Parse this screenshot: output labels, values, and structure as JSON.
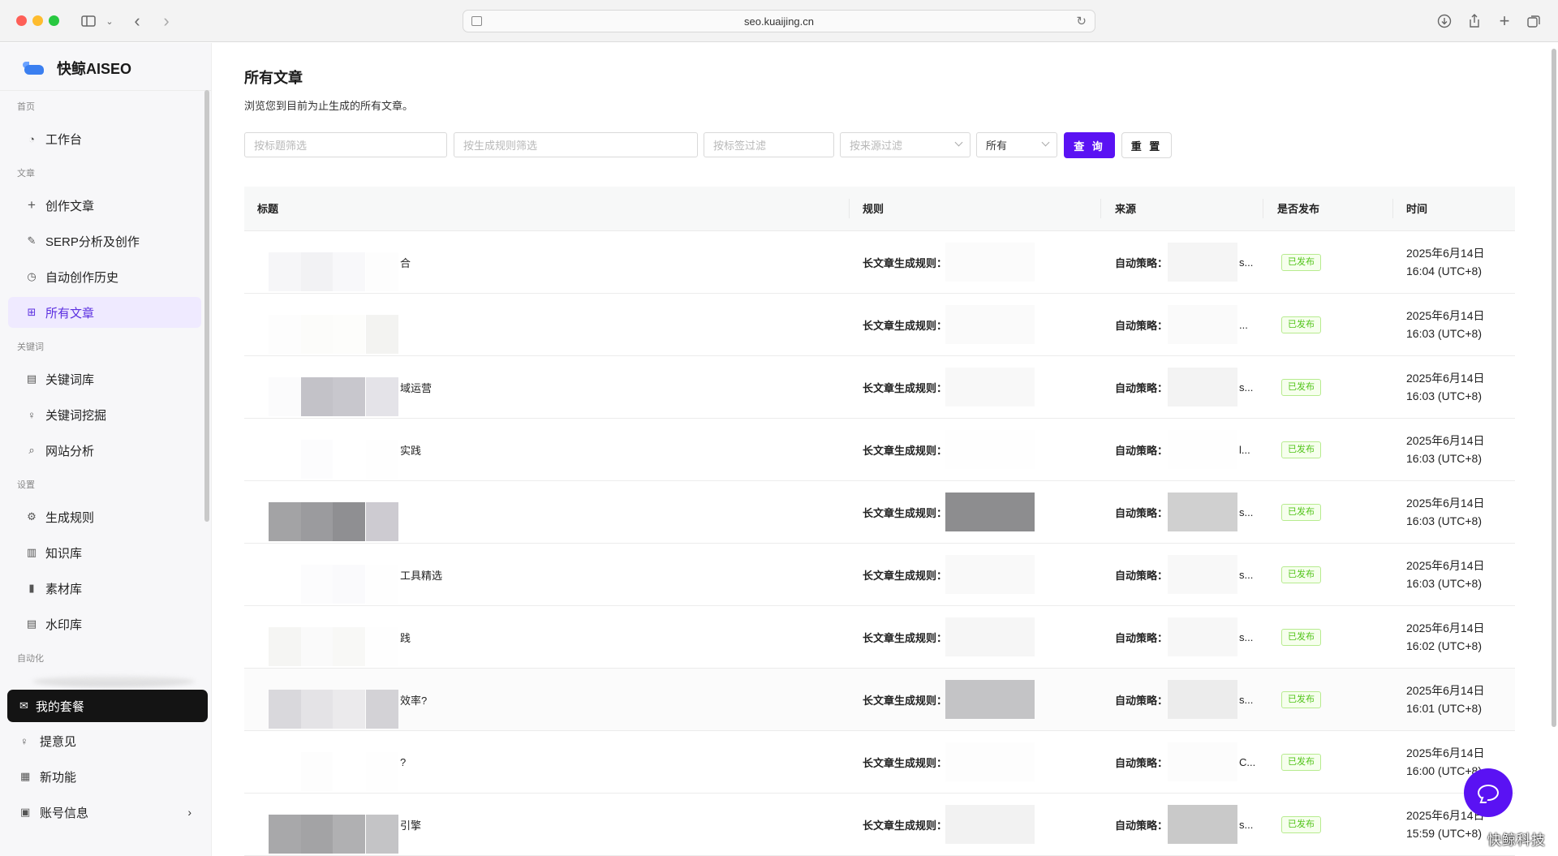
{
  "browser": {
    "url": "seo.kuaijing.cn"
  },
  "brand": {
    "name": "快鲸AISEO"
  },
  "sidebar": {
    "groups": {
      "home": "首页",
      "article": "文章",
      "keyword": "关键词",
      "settings": "设置",
      "automation": "自动化"
    },
    "items": {
      "workbench": "工作台",
      "create_article": "创作文章",
      "serp": "SERP分析及创作",
      "auto_history": "自动创作历史",
      "all_articles": "所有文章",
      "keyword_library": "关键词库",
      "keyword_mining": "关键词挖掘",
      "site_analysis": "网站分析",
      "rules": "生成规则",
      "knowledge": "知识库",
      "materials": "素材库",
      "watermark": "水印库"
    },
    "plan": "我的套餐",
    "feedback": "提意见",
    "new_features": "新功能",
    "account": "账号信息"
  },
  "main": {
    "title": "所有文章",
    "subtitle": "浏览您到目前为止生成的所有文章。",
    "filters": {
      "title_placeholder": "按标题筛选",
      "rule_placeholder": "按生成规则筛选",
      "tag_placeholder": "按标签过滤",
      "source_placeholder": "按来源过滤",
      "status_value": "所有",
      "query": "查 询",
      "reset": "重 置"
    },
    "table": {
      "headers": {
        "title": "标题",
        "rule": "规则",
        "source": "来源",
        "published": "是否发布",
        "time": "时间"
      },
      "rows": [
        {
          "title": "合",
          "rule": "长文章生成规则：",
          "source": "自动策略：",
          "tail": "s...",
          "status": "已发布",
          "date": "2025年6月14日",
          "clock": "16:04 (UTC+8)"
        },
        {
          "title": "",
          "rule": "长文章生成规则：",
          "source": "自动策略：",
          "tail": "...",
          "status": "已发布",
          "date": "2025年6月14日",
          "clock": "16:03 (UTC+8)"
        },
        {
          "title": "域运营",
          "rule": "长文章生成规则：",
          "source": "自动策略：",
          "tail": "s...",
          "status": "已发布",
          "date": "2025年6月14日",
          "clock": "16:03 (UTC+8)"
        },
        {
          "title": "实践",
          "rule": "长文章生成规则：",
          "source": "自动策略：",
          "tail": "l...",
          "status": "已发布",
          "date": "2025年6月14日",
          "clock": "16:03 (UTC+8)"
        },
        {
          "title": "",
          "rule": "长文章生成规则：",
          "source": "自动策略：",
          "tail": "s...",
          "status": "已发布",
          "date": "2025年6月14日",
          "clock": "16:03 (UTC+8)"
        },
        {
          "title": "工具精选",
          "rule": "长文章生成规则：",
          "source": "自动策略：",
          "tail": "s...",
          "status": "已发布",
          "date": "2025年6月14日",
          "clock": "16:03 (UTC+8)"
        },
        {
          "title": "践",
          "rule": "长文章生成规则：",
          "source": "自动策略：",
          "tail": "s...",
          "status": "已发布",
          "date": "2025年6月14日",
          "clock": "16:02 (UTC+8)"
        },
        {
          "title": "效率?",
          "rule": "长文章生成规则：",
          "source": "自动策略：",
          "tail": "s...",
          "status": "已发布",
          "date": "2025年6月14日",
          "clock": "16:01 (UTC+8)"
        },
        {
          "title": "?",
          "rule": "长文章生成规则：",
          "source": "自动策略：",
          "tail": "C...",
          "status": "已发布",
          "date": "2025年6月14日",
          "clock": "16:00 (UTC+8)"
        },
        {
          "title": "引擎",
          "rule": "长文章生成规则：",
          "source": "自动策略：",
          "tail": "s...",
          "status": "已发布",
          "date": "2025年6月14日",
          "clock": "15:59 (UTC+8)"
        }
      ]
    }
  },
  "overlay": {
    "watermark": "快鲸科技"
  },
  "colors": {
    "accent": "#5a12f3",
    "published_green": "#52c41a",
    "active_bg": "#efeaff"
  }
}
